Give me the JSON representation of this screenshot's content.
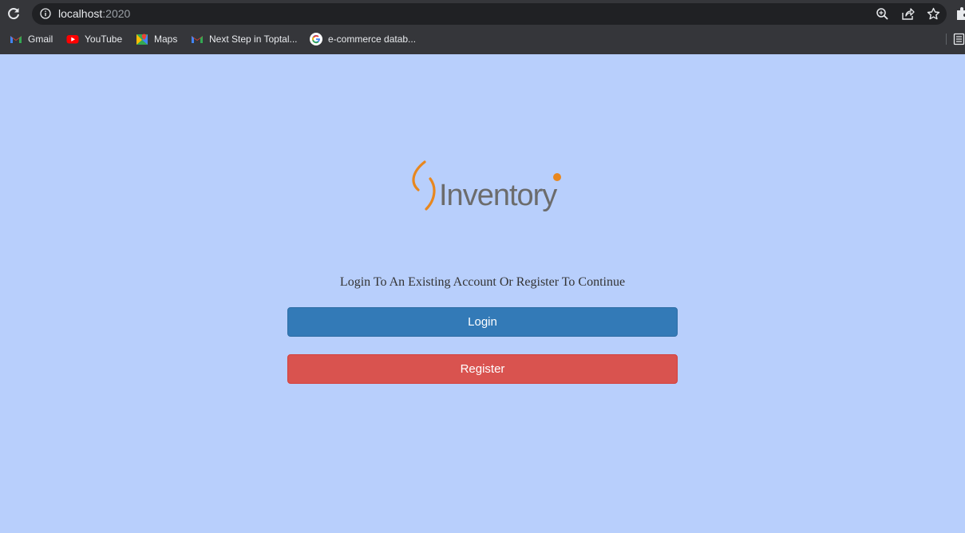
{
  "browser": {
    "url_host": "localhost",
    "url_port": ":2020",
    "bookmarks": [
      {
        "label": "Gmail",
        "icon": "gmail-icon"
      },
      {
        "label": "YouTube",
        "icon": "youtube-icon"
      },
      {
        "label": "Maps",
        "icon": "maps-icon"
      },
      {
        "label": "Next Step in Toptal...",
        "icon": "gmail-icon"
      },
      {
        "label": "e-commerce datab...",
        "icon": "google-icon"
      }
    ]
  },
  "page": {
    "logo_text": "Inventory",
    "prompt": "Login To An Existing Account Or Register To Continue",
    "login_label": "Login",
    "register_label": "Register"
  },
  "colors": {
    "background": "#b8cffc",
    "login": "#337ab7",
    "register": "#d9534f",
    "logo_accent": "#e8871e"
  }
}
